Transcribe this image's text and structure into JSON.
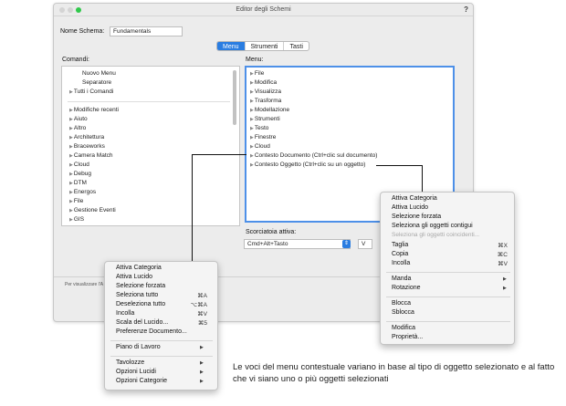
{
  "window": {
    "title": "Editor degli Schemi",
    "help_icon": "?",
    "name_label": "Nome Schema:",
    "name_value": "Fundamentals",
    "tabs": [
      "Menu",
      "Strumenti",
      "Tasti"
    ],
    "commands_label": "Comandi:",
    "menus_label": "Menu:",
    "commands": {
      "top": [
        "Nuovo Menu",
        "Separatore"
      ],
      "all_commands": "Tutti i Comandi",
      "list": [
        "Modifiche recenti",
        "Aiuto",
        "Altro",
        "Architettura",
        "Braceworks",
        "Camera Match",
        "Cloud",
        "Debug",
        "DTM",
        "Energos",
        "File",
        "Gestione Eventi",
        "GIS"
      ]
    },
    "menus": [
      "File",
      "Modifica",
      "Visualizza",
      "Trasforma",
      "Modellazione",
      "Strumenti",
      "Testo",
      "Finestre",
      "Cloud",
      "Contesto Documento (Ctrl+clic sul documento)",
      "Contesto Oggetto (Ctrl+clic su un oggetto)"
    ],
    "shortcut_label": "Scorciatoia attiva:",
    "shortcut_value": "Cmd+Alt+Tasto",
    "shortcut_key": "V",
    "bottom_note": "Per visualizzare l'A"
  },
  "ctx_document": {
    "items": [
      {
        "label": "Attiva Categoria",
        "shortcut": ""
      },
      {
        "label": "Attiva Lucido",
        "shortcut": ""
      },
      {
        "label": "Selezione forzata",
        "shortcut": ""
      },
      {
        "label": "Seleziona tutto",
        "shortcut": "⌘A"
      },
      {
        "label": "Deseleziona tutto",
        "shortcut": "⌥⌘A"
      },
      {
        "label": "Incolla",
        "shortcut": "⌘V"
      },
      {
        "label": "Scala del Lucido...",
        "shortcut": "⌘5"
      },
      {
        "label": "Preferenze Documento...",
        "shortcut": ""
      }
    ],
    "submenu_1": [
      "Piano di Lavoro"
    ],
    "submenu_2": [
      "Tavolozze",
      "Opzioni Lucidi",
      "Opzioni Categorie"
    ]
  },
  "ctx_object": {
    "group_1": [
      "Attiva Categoria",
      "Attiva Lucido",
      "Selezione forzata",
      "Seleziona gli oggetti contigui"
    ],
    "disabled": "Seleziona gli oggetti coincidenti...",
    "group_2": [
      {
        "label": "Taglia",
        "shortcut": "⌘X"
      },
      {
        "label": "Copia",
        "shortcut": "⌘C"
      },
      {
        "label": "Incolla",
        "shortcut": "⌘V"
      }
    ],
    "group_3": [
      "Manda",
      "Rotazione"
    ],
    "group_4": [
      "Blocca",
      "Sblocca"
    ],
    "group_5": [
      "Modifica",
      "Proprietà..."
    ]
  },
  "caption": "Le voci del menu contestuale variano in base al tipo di oggetto selezionato e al fatto che vi siano uno o più oggetti selezionati",
  "colors": {
    "accent": "#2a7de1",
    "focus_ring": "#4d90e8"
  }
}
